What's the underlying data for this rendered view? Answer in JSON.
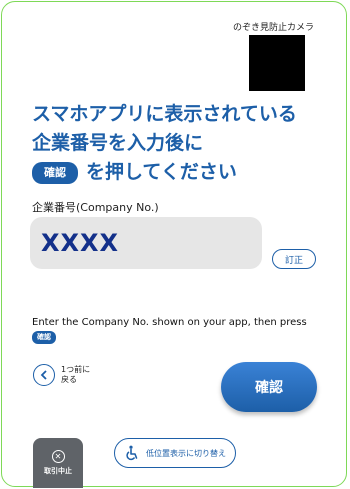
{
  "camera": {
    "label": "のぞき見防止カメラ"
  },
  "heading": {
    "line1": "スマホアプリに表示されている",
    "line2": "企業番号を入力後に",
    "inline_button": "確認",
    "line3_suffix": "を押してください"
  },
  "company_field": {
    "label": "企業番号(Company No.)",
    "value": "XXXX"
  },
  "fix_button": {
    "label": "訂正"
  },
  "english": {
    "text": "Enter the Company No. shown on your app, then press",
    "inline_button": "確認"
  },
  "back": {
    "line1": "1つ前に",
    "line2": "戻る"
  },
  "confirm_button": {
    "label": "確認"
  },
  "cancel_button": {
    "label": "取引中止"
  },
  "low_position_button": {
    "label": "低位置表示に切り替え",
    "icon": "wheelchair-icon"
  },
  "colors": {
    "accent": "#1d5fa8",
    "frame": "#7ed957",
    "dark_button": "#5f6368"
  }
}
